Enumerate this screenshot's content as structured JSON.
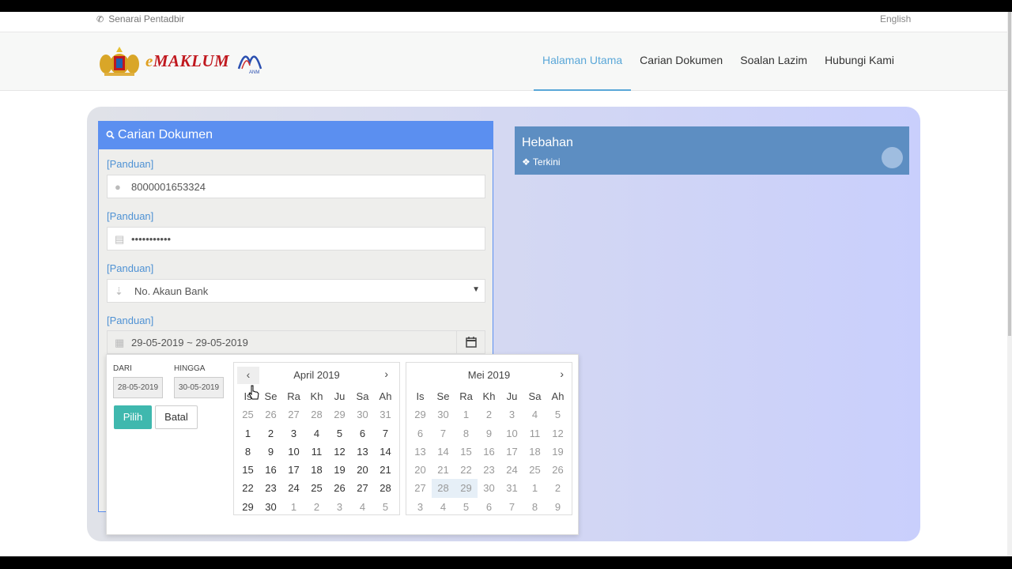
{
  "topbar": {
    "admin_label": "Senarai Pentadbir",
    "language": "English"
  },
  "brand": {
    "logo_text_e": "e",
    "logo_text_rest": "MAKLUM",
    "anm_text": "ANM"
  },
  "nav": {
    "items": [
      {
        "label": "Halaman Utama",
        "active": true
      },
      {
        "label": "Carian Dokumen"
      },
      {
        "label": "Soalan Lazim"
      },
      {
        "label": "Hubungi Kami"
      }
    ]
  },
  "search_panel": {
    "title": "Carian Dokumen",
    "guide_label": "[Panduan]",
    "id_value": "8000001653324",
    "password_value": "•••••••••••",
    "doc_type_selected": "No. Akaun Bank",
    "date_range": "29-05-2019 ~ 29-05-2019"
  },
  "datepicker": {
    "from_label": "DARI",
    "to_label": "HINGGA",
    "from_value": "28-05-2019",
    "to_value": "30-05-2019",
    "apply_label": "Pilih",
    "cancel_label": "Batal",
    "weekdays": [
      "Is",
      "Se",
      "Ra",
      "Kh",
      "Ju",
      "Sa",
      "Ah"
    ],
    "left_month": {
      "title": "April 2019",
      "weeks": [
        [
          [
            "25",
            1
          ],
          [
            "26",
            1
          ],
          [
            "27",
            1
          ],
          [
            "28",
            1
          ],
          [
            "29",
            1
          ],
          [
            "30",
            1
          ],
          [
            "31",
            1
          ]
        ],
        [
          [
            "1",
            0
          ],
          [
            "2",
            0
          ],
          [
            "3",
            0
          ],
          [
            "4",
            0
          ],
          [
            "5",
            0
          ],
          [
            "6",
            0
          ],
          [
            "7",
            0
          ]
        ],
        [
          [
            "8",
            0
          ],
          [
            "9",
            0
          ],
          [
            "10",
            0
          ],
          [
            "11",
            0
          ],
          [
            "12",
            0
          ],
          [
            "13",
            0
          ],
          [
            "14",
            0
          ]
        ],
        [
          [
            "15",
            0
          ],
          [
            "16",
            0
          ],
          [
            "17",
            0
          ],
          [
            "18",
            0
          ],
          [
            "19",
            0
          ],
          [
            "20",
            0
          ],
          [
            "21",
            0
          ]
        ],
        [
          [
            "22",
            0
          ],
          [
            "23",
            0
          ],
          [
            "24",
            0
          ],
          [
            "25",
            0
          ],
          [
            "26",
            0
          ],
          [
            "27",
            0
          ],
          [
            "28",
            0
          ]
        ],
        [
          [
            "29",
            0
          ],
          [
            "30",
            0
          ],
          [
            "1",
            1
          ],
          [
            "2",
            1
          ],
          [
            "3",
            1
          ],
          [
            "4",
            1
          ],
          [
            "5",
            1
          ]
        ]
      ]
    },
    "right_month": {
      "title": "Mei 2019",
      "weeks": [
        [
          [
            "29",
            1
          ],
          [
            "30",
            1
          ],
          [
            "1",
            1
          ],
          [
            "2",
            1
          ],
          [
            "3",
            1
          ],
          [
            "4",
            1
          ],
          [
            "5",
            1
          ]
        ],
        [
          [
            "6",
            1
          ],
          [
            "7",
            1
          ],
          [
            "8",
            1
          ],
          [
            "9",
            1
          ],
          [
            "10",
            1
          ],
          [
            "11",
            1
          ],
          [
            "12",
            1
          ]
        ],
        [
          [
            "13",
            1
          ],
          [
            "14",
            1
          ],
          [
            "15",
            1
          ],
          [
            "16",
            1
          ],
          [
            "17",
            1
          ],
          [
            "18",
            1
          ],
          [
            "19",
            1
          ]
        ],
        [
          [
            "20",
            1
          ],
          [
            "21",
            1
          ],
          [
            "22",
            1
          ],
          [
            "23",
            1
          ],
          [
            "24",
            1
          ],
          [
            "25",
            1
          ],
          [
            "26",
            1
          ]
        ],
        [
          [
            "27",
            1
          ],
          [
            "28",
            2
          ],
          [
            "29",
            2
          ],
          [
            "30",
            1
          ],
          [
            "31",
            1
          ],
          [
            "1",
            1
          ],
          [
            "2",
            1
          ]
        ],
        [
          [
            "3",
            1
          ],
          [
            "4",
            1
          ],
          [
            "5",
            1
          ],
          [
            "6",
            1
          ],
          [
            "7",
            1
          ],
          [
            "8",
            1
          ],
          [
            "9",
            1
          ]
        ]
      ]
    }
  },
  "announcements": {
    "title": "Hebahan",
    "subtitle": "Terkini"
  }
}
